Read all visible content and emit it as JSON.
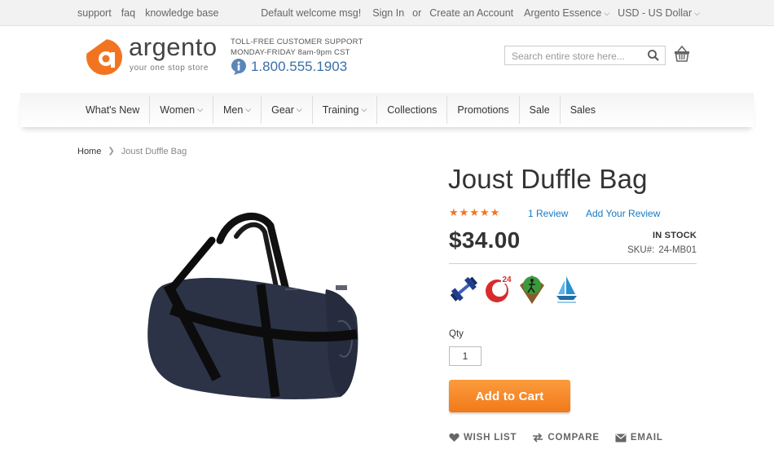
{
  "topbar": {
    "left_links": [
      "support",
      "faq",
      "knowledge base"
    ],
    "welcome": "Default welcome msg!",
    "sign_in": "Sign In",
    "or": "or",
    "create_account": "Create an Account",
    "store": "Argento Essence",
    "currency": "USD - US Dollar"
  },
  "logo": {
    "name": "argento",
    "tagline": "your one stop store"
  },
  "support": {
    "line1": "TOLL-FREE CUSTOMER SUPPORT",
    "line2": "MONDAY-FRIDAY 8am-9pm CST",
    "phone": "1.800.555.1903"
  },
  "search": {
    "placeholder": "Search entire store here..."
  },
  "nav": [
    "What's New",
    "Women",
    "Men",
    "Gear",
    "Training",
    "Collections",
    "Promotions",
    "Sale",
    "Sales"
  ],
  "breadcrumb": {
    "home": "Home",
    "current": "Joust Duffle Bag"
  },
  "product": {
    "title": "Joust Duffle Bag",
    "rating_stars": 5,
    "reviews": "1 Review",
    "add_review": "Add Your Review",
    "price": "$34.00",
    "stock": "IN STOCK",
    "sku_label": "SKU#:",
    "sku": "24-MB01",
    "qty_label": "Qty",
    "qty": "1",
    "add_to_cart": "Add to Cart",
    "badge_24": "24",
    "actions": {
      "wish": "WISH LIST",
      "compare": "COMPARE",
      "email": "EMAIL"
    }
  },
  "colors": {
    "accent": "#f27421",
    "link": "#1979c3",
    "phone": "#3a6fa6"
  }
}
